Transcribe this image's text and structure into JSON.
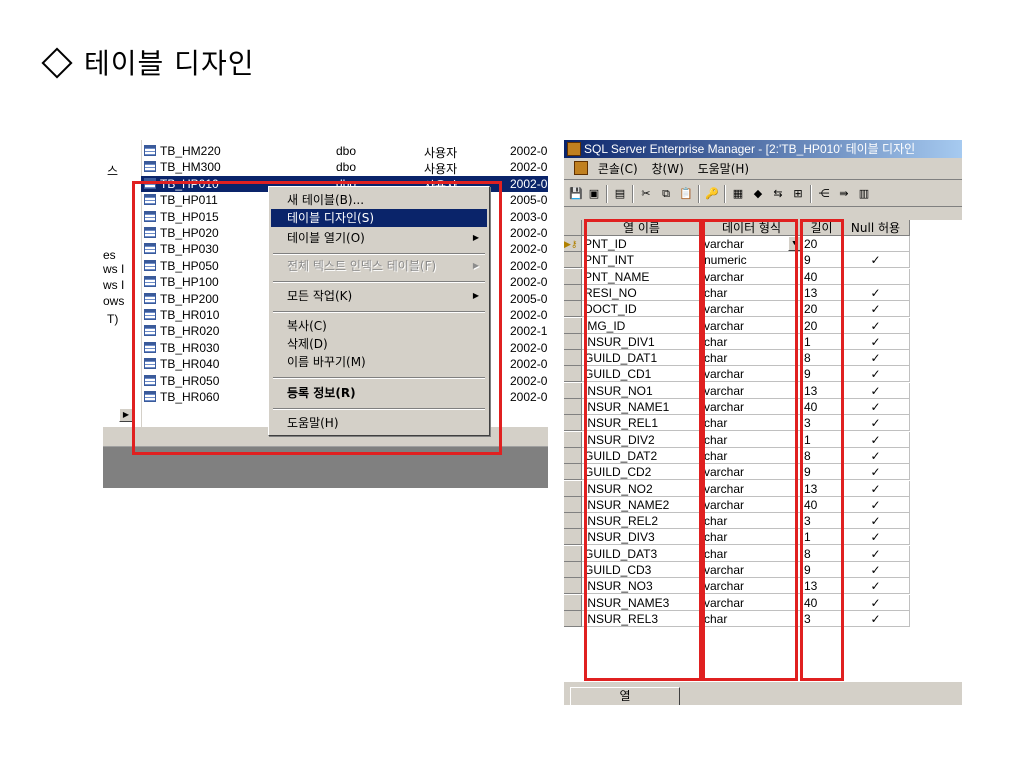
{
  "slide": {
    "title": "테이블 디자인"
  },
  "left": {
    "tree_fragments": [
      "스",
      "es",
      "ws I",
      "ws I",
      "ows",
      "T)"
    ],
    "rows": [
      {
        "name": "TB_HM220",
        "owner": "dbo",
        "type": "사용자",
        "date": "2002-0"
      },
      {
        "name": "TB_HM300",
        "owner": "dbo",
        "type": "사용자",
        "date": "2002-0"
      },
      {
        "name": "TB_HP010",
        "owner": "dbo",
        "type": "사용자",
        "date": "2002-0"
      },
      {
        "name": "TB_HP011",
        "owner": "",
        "type": "",
        "date": "2005-0"
      },
      {
        "name": "TB_HP015",
        "owner": "",
        "type": "",
        "date": "2003-0"
      },
      {
        "name": "TB_HP020",
        "owner": "",
        "type": "",
        "date": "2002-0"
      },
      {
        "name": "TB_HP030",
        "owner": "",
        "type": "",
        "date": "2002-0"
      },
      {
        "name": "TB_HP050",
        "owner": "",
        "type": "",
        "date": "2002-0"
      },
      {
        "name": "TB_HP100",
        "owner": "",
        "type": "",
        "date": "2002-0"
      },
      {
        "name": "TB_HP200",
        "owner": "",
        "type": "",
        "date": "2005-0"
      },
      {
        "name": "TB_HR010",
        "owner": "",
        "type": "",
        "date": "2002-0"
      },
      {
        "name": "TB_HR020",
        "owner": "",
        "type": "",
        "date": "2002-1"
      },
      {
        "name": "TB_HR030",
        "owner": "",
        "type": "",
        "date": "2002-0"
      },
      {
        "name": "TB_HR040",
        "owner": "",
        "type": "",
        "date": "2002-0"
      },
      {
        "name": "TB_HR050",
        "owner": "",
        "type": "",
        "date": "2002-0"
      },
      {
        "name": "TB_HR060",
        "owner": "",
        "type": "",
        "date": "2002-0"
      }
    ],
    "context_menu": {
      "new_table": "새 테이블(B)...",
      "design_table": "테이블 디자인(S)",
      "open_table": "테이블 열기(O)",
      "fulltext": "전체 텍스트 인덱스 테이블(F)",
      "all_tasks": "모든 작업(K)",
      "copy": "복사(C)",
      "delete": "삭제(D)",
      "rename": "이름 바꾸기(M)",
      "properties": "등록 정보(R)",
      "help": "도움말(H)"
    }
  },
  "right": {
    "window_title": "SQL Server Enterprise Manager - [2:'TB_HP010' 테이블 디자인",
    "menu": [
      "콘솔(C)",
      "창(W)",
      "도움말(H)"
    ],
    "columns": [
      "열 이름",
      "데이터 형식",
      "길이",
      "Null 허용"
    ],
    "rows": [
      {
        "name": "PNT_ID",
        "type": "varchar",
        "len": "20",
        "nullable": ""
      },
      {
        "name": "PNT_INT",
        "type": "numeric",
        "len": "9",
        "nullable": "✓"
      },
      {
        "name": "PNT_NAME",
        "type": "varchar",
        "len": "40",
        "nullable": ""
      },
      {
        "name": "RESI_NO",
        "type": "char",
        "len": "13",
        "nullable": "✓"
      },
      {
        "name": "DOCT_ID",
        "type": "varchar",
        "len": "20",
        "nullable": "✓"
      },
      {
        "name": "IMG_ID",
        "type": "varchar",
        "len": "20",
        "nullable": "✓"
      },
      {
        "name": "INSUR_DIV1",
        "type": "char",
        "len": "1",
        "nullable": "✓"
      },
      {
        "name": "GUILD_DAT1",
        "type": "char",
        "len": "8",
        "nullable": "✓"
      },
      {
        "name": "GUILD_CD1",
        "type": "varchar",
        "len": "9",
        "nullable": "✓"
      },
      {
        "name": "INSUR_NO1",
        "type": "varchar",
        "len": "13",
        "nullable": "✓"
      },
      {
        "name": "INSUR_NAME1",
        "type": "varchar",
        "len": "40",
        "nullable": "✓"
      },
      {
        "name": "INSUR_REL1",
        "type": "char",
        "len": "3",
        "nullable": "✓"
      },
      {
        "name": "INSUR_DIV2",
        "type": "char",
        "len": "1",
        "nullable": "✓"
      },
      {
        "name": "GUILD_DAT2",
        "type": "char",
        "len": "8",
        "nullable": "✓"
      },
      {
        "name": "GUILD_CD2",
        "type": "varchar",
        "len": "9",
        "nullable": "✓"
      },
      {
        "name": "INSUR_NO2",
        "type": "varchar",
        "len": "13",
        "nullable": "✓"
      },
      {
        "name": "INSUR_NAME2",
        "type": "varchar",
        "len": "40",
        "nullable": "✓"
      },
      {
        "name": "INSUR_REL2",
        "type": "char",
        "len": "3",
        "nullable": "✓"
      },
      {
        "name": "INSUR_DIV3",
        "type": "char",
        "len": "1",
        "nullable": "✓"
      },
      {
        "name": "GUILD_DAT3",
        "type": "char",
        "len": "8",
        "nullable": "✓"
      },
      {
        "name": "GUILD_CD3",
        "type": "varchar",
        "len": "9",
        "nullable": "✓"
      },
      {
        "name": "INSUR_NO3",
        "type": "varchar",
        "len": "13",
        "nullable": "✓"
      },
      {
        "name": "INSUR_NAME3",
        "type": "varchar",
        "len": "40",
        "nullable": "✓"
      },
      {
        "name": "INSUR_REL3",
        "type": "char",
        "len": "3",
        "nullable": "✓"
      }
    ],
    "bottom_tab": "열"
  },
  "colors": {
    "highlight": "#0a246a",
    "annotation_red": "#e02020",
    "window_face": "#d4d0c8"
  }
}
